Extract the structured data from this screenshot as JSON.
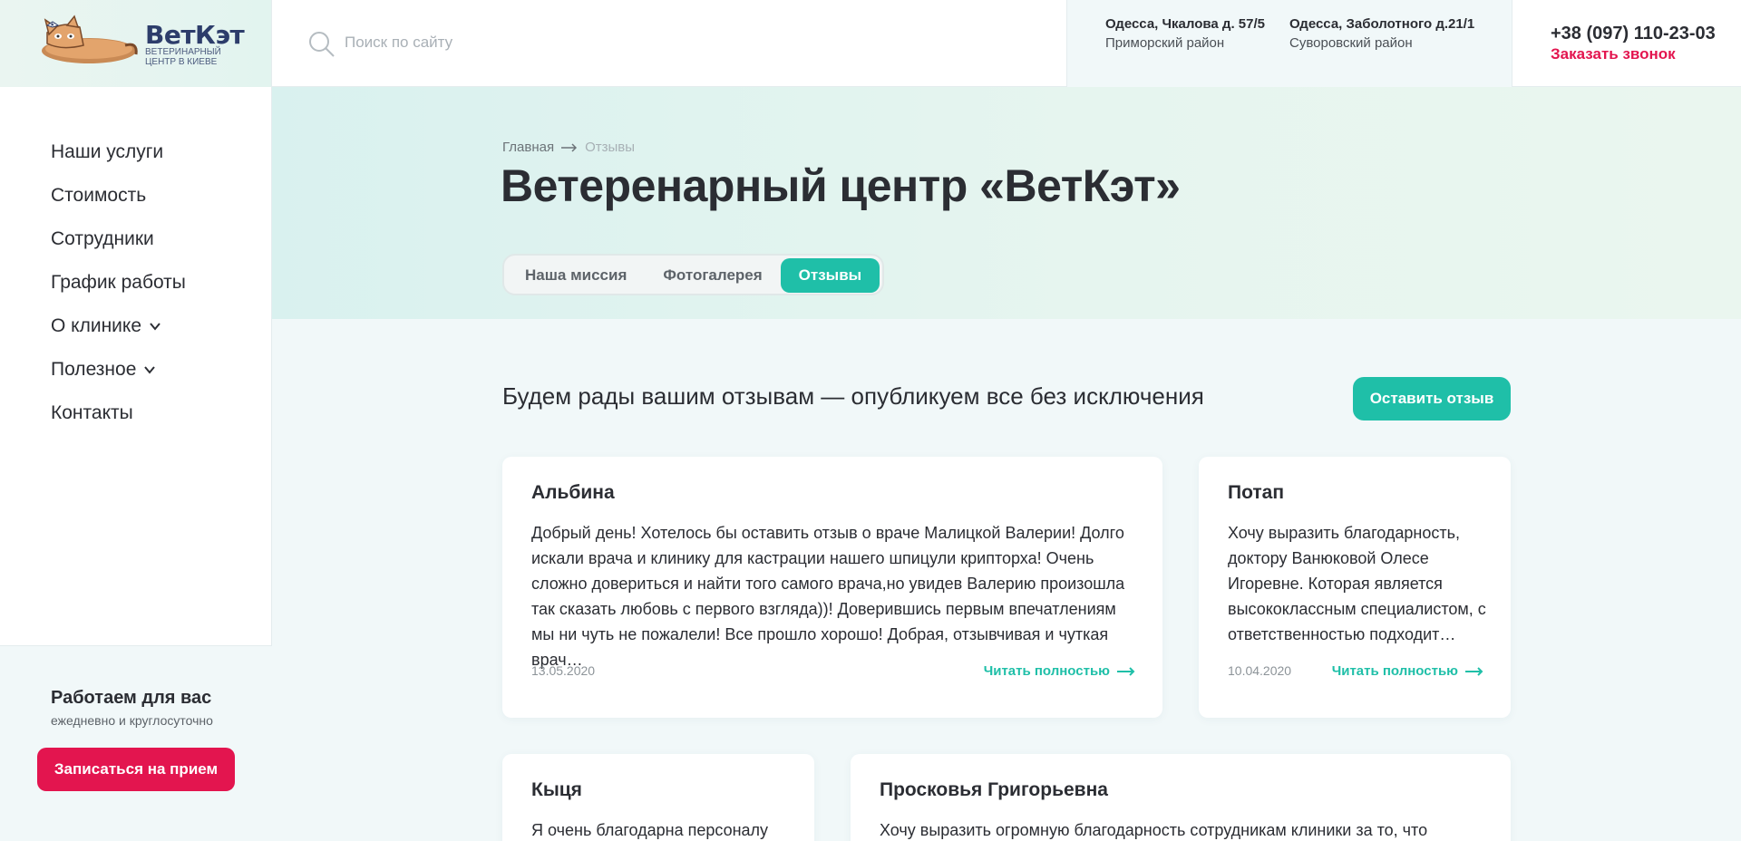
{
  "logo": {
    "name": "ВетКэт",
    "subtitle": "ветеринарный центр в киеве"
  },
  "search": {
    "placeholder": "Поиск по сайту"
  },
  "addresses": [
    {
      "street": "Одесса, Чкалова д. 57/5",
      "district": "Приморский район"
    },
    {
      "street": "Одесса, Заболотного д.21/1",
      "district": "Суворовский район"
    }
  ],
  "contact": {
    "phone": "+38 (097) 110-23-03",
    "callback": "Заказать звонок"
  },
  "nav": {
    "items": [
      {
        "label": "Наши услуги"
      },
      {
        "label": "Стоимость"
      },
      {
        "label": "Сотрудники"
      },
      {
        "label": "График работы"
      },
      {
        "label": "О клинике"
      },
      {
        "label": "Полезное"
      },
      {
        "label": "Контакты"
      }
    ]
  },
  "sidebar_footer": {
    "title": "Работаем для вас",
    "subtitle": "ежедневно и круглосуточно",
    "button": "Записаться на прием"
  },
  "breadcrumb": {
    "home": "Главная",
    "current": "Отзывы"
  },
  "page_title": "Ветеренарный центр «ВетКэт»",
  "tabs": [
    {
      "label": "Наша миссия",
      "active": false
    },
    {
      "label": "Фотогалерея",
      "active": false
    },
    {
      "label": "Отзывы",
      "active": true
    }
  ],
  "intro": "Будем рады вашим отзывам — опубликуем все без исключения",
  "leave_review_button": "Оставить отзыв",
  "reviews": [
    {
      "name": "Альбина",
      "text": "Добрый день! Хотелось бы оставить отзыв о враче Малицкой Валерии! Долго искали врача и клинику для кастрации нашего шпицули крипторха! Очень сложно довериться и найти того самого врача,но увидев Валерию произошла так сказать любовь с первого взгляда))! Доверившись первым впечатлениям мы ни чуть не пожалели! Все прошло хорошо! Добрая, отзывчивая и чуткая врач…",
      "date": "13.05.2020",
      "more": "Читать полностью"
    },
    {
      "name": "Потап",
      "text": "Хочу выразить благодарность, доктору Ванюковой Олесе Игоревне. Которая является высококлассным специалистом, с ответственностью подходит…",
      "date": "10.04.2020",
      "more": "Читать полностью"
    },
    {
      "name": "Кыця",
      "text": "Я очень благодарна персоналу"
    },
    {
      "name": "Просковья Григорьевна",
      "text": "Хочу выразить огромную благодарность сотрудникам клиники за то, что"
    }
  ],
  "colors": {
    "accent": "#1fbfa8",
    "brand_red": "#e3154f",
    "text": "#2b2d33"
  }
}
